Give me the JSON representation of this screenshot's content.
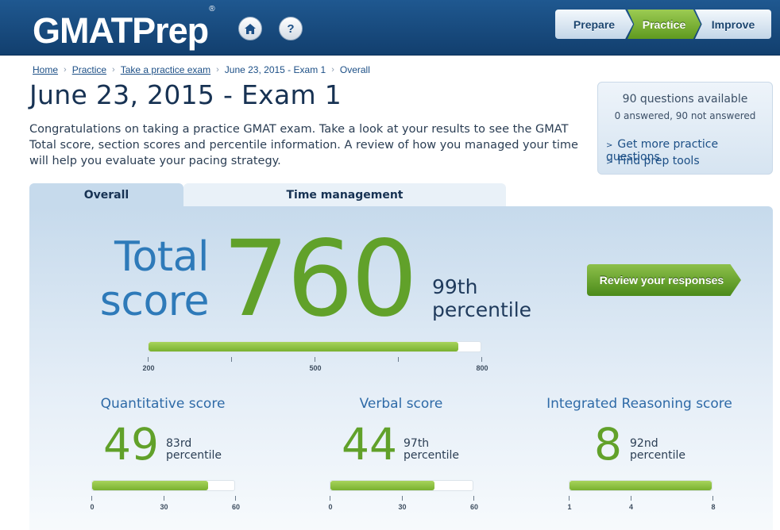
{
  "header": {
    "logo_text": "GMATPrep",
    "logo_mark": "®",
    "home_icon": "home-icon",
    "help_label": "?",
    "nav": {
      "prepare": "Prepare",
      "practice": "Practice",
      "improve": "Improve"
    },
    "colors": {
      "header_bg": "#1f5890",
      "accent_green": "#61a12a"
    }
  },
  "breadcrumb": {
    "home": "Home",
    "practice": "Practice",
    "take_exam": "Take a practice exam",
    "exam": "June 23, 2015 - Exam 1",
    "current": "Overall",
    "separator": "›"
  },
  "page_title": "June 23, 2015 - Exam 1",
  "intro": "Congratulations on taking a practice GMAT exam. Take a look at your results to see the GMAT Total score, section scores and percentile information. A review of how you managed your time will help you evaluate your pacing strategy.",
  "sidebar": {
    "questions_available": "90 questions available",
    "answered_summary": "0 answered, 90 not answered",
    "links": [
      "Get more practice questions",
      "Find prep tools"
    ]
  },
  "tabs": {
    "overall": "Overall",
    "time_management": "Time management"
  },
  "total": {
    "label_line1": "Total",
    "label_line2": "score",
    "score": "760",
    "percentile_value": "99th",
    "percentile_word": "percentile",
    "bar_min": 200,
    "bar_max": 800,
    "bar_value": 760,
    "ticks": [
      "200",
      "500",
      "800"
    ]
  },
  "review_button": "Review your responses",
  "sections": [
    {
      "title": "Quantitative score",
      "score": "49",
      "percentile_value": "83rd",
      "percentile_word": "percentile",
      "bar_min": 0,
      "bar_max": 60,
      "bar_value": 49,
      "ticks": [
        "0",
        "30",
        "60"
      ]
    },
    {
      "title": "Verbal score",
      "score": "44",
      "percentile_value": "97th",
      "percentile_word": "percentile",
      "bar_min": 0,
      "bar_max": 60,
      "bar_value": 44,
      "ticks": [
        "0",
        "30",
        "60"
      ]
    },
    {
      "title": "Integrated Reasoning score",
      "score": "8",
      "percentile_value": "92nd",
      "percentile_word": "percentile",
      "bar_min": 1,
      "bar_max": 8,
      "bar_value": 8,
      "ticks": [
        "1",
        "4",
        "8"
      ]
    }
  ]
}
